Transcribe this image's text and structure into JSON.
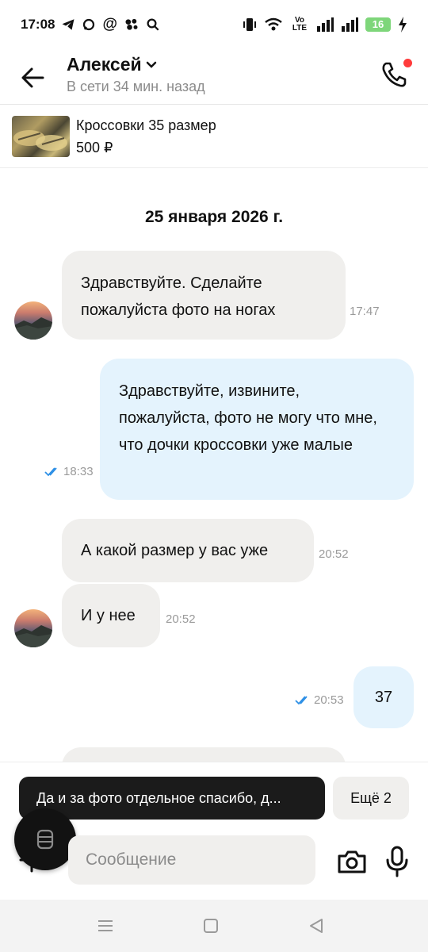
{
  "status_bar": {
    "time": "17:08",
    "left_icons": [
      "telegram-icon",
      "max-messenger-icon",
      "at-icon",
      "vk-icon",
      "search-icon"
    ],
    "right_icons": [
      "vibrate-icon",
      "wifi-icon",
      "volte-icon",
      "signal-icon",
      "signal-icon",
      "battery-icon",
      "charging-icon"
    ],
    "volte_text": "Vo LTE",
    "battery_level": "16"
  },
  "header": {
    "contact_name": "Алексей",
    "contact_status": "В сети 34 мин. назад",
    "call_has_notification": true
  },
  "product": {
    "title": "Кроссовки 35 размер",
    "price": "500 ₽"
  },
  "chat": {
    "date": "25 января 2026 г.",
    "messages": [
      {
        "direction": "in",
        "text": "Здравствуйте. Сделайте пожалуйста фото на ногах",
        "time": "17:47"
      },
      {
        "direction": "out",
        "text": "Здравствуйте, извините, пожалуйста, фото не могу что мне, что дочки кроссовки уже малые",
        "time": "18:33",
        "read": true
      },
      {
        "direction": "in",
        "text": "А какой размер у вас уже",
        "time": "20:52"
      },
      {
        "direction": "in",
        "text": "И у нее",
        "time": "20:52"
      },
      {
        "direction": "out",
        "text": "37",
        "time": "20:53",
        "read": true
      }
    ]
  },
  "suggestions": {
    "first": "Да и за фото отдельное спасибо, д...",
    "more": "Ещё 2"
  },
  "composer": {
    "placeholder": "Сообщение"
  },
  "colors": {
    "incoming_bubble": "#f0efed",
    "outgoing_bubble": "#e4f3fd",
    "read_check": "#2e90e6",
    "notification_dot": "#ff3b3b"
  }
}
